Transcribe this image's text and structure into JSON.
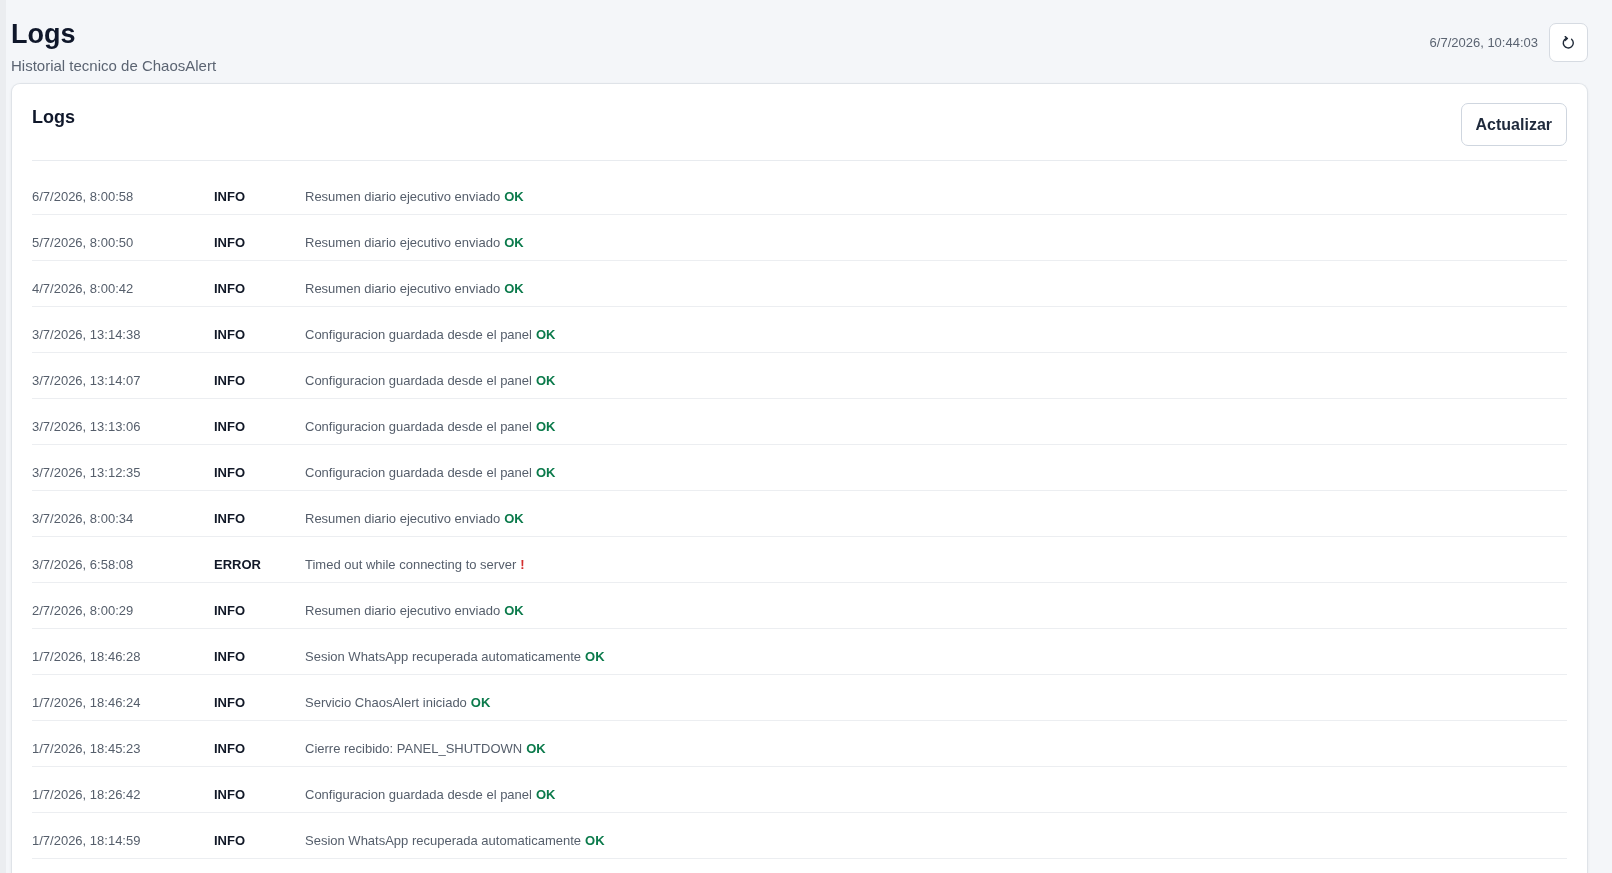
{
  "header": {
    "title": "Logs",
    "subtitle": "Historial tecnico de ChaosAlert",
    "timestamp": "6/7/2026, 10:44:03"
  },
  "card": {
    "title": "Logs",
    "button": "Actualizar"
  },
  "logs": [
    {
      "time": "6/7/2026, 8:00:58",
      "level": "INFO",
      "message": "Resumen diario ejecutivo enviado",
      "status": {
        "text": "OK",
        "kind": "ok"
      }
    },
    {
      "time": "5/7/2026, 8:00:50",
      "level": "INFO",
      "message": "Resumen diario ejecutivo enviado",
      "status": {
        "text": "OK",
        "kind": "ok"
      }
    },
    {
      "time": "4/7/2026, 8:00:42",
      "level": "INFO",
      "message": "Resumen diario ejecutivo enviado",
      "status": {
        "text": "OK",
        "kind": "ok"
      }
    },
    {
      "time": "3/7/2026, 13:14:38",
      "level": "INFO",
      "message": "Configuracion guardada desde el panel",
      "status": {
        "text": "OK",
        "kind": "ok"
      }
    },
    {
      "time": "3/7/2026, 13:14:07",
      "level": "INFO",
      "message": "Configuracion guardada desde el panel",
      "status": {
        "text": "OK",
        "kind": "ok"
      }
    },
    {
      "time": "3/7/2026, 13:13:06",
      "level": "INFO",
      "message": "Configuracion guardada desde el panel",
      "status": {
        "text": "OK",
        "kind": "ok"
      }
    },
    {
      "time": "3/7/2026, 13:12:35",
      "level": "INFO",
      "message": "Configuracion guardada desde el panel",
      "status": {
        "text": "OK",
        "kind": "ok"
      }
    },
    {
      "time": "3/7/2026, 8:00:34",
      "level": "INFO",
      "message": "Resumen diario ejecutivo enviado",
      "status": {
        "text": "OK",
        "kind": "ok"
      }
    },
    {
      "time": "3/7/2026, 6:58:08",
      "level": "ERROR",
      "message": "Timed out while connecting to server",
      "status": {
        "text": "!",
        "kind": "error"
      }
    },
    {
      "time": "2/7/2026, 8:00:29",
      "level": "INFO",
      "message": "Resumen diario ejecutivo enviado",
      "status": {
        "text": "OK",
        "kind": "ok"
      }
    },
    {
      "time": "1/7/2026, 18:46:28",
      "level": "INFO",
      "message": "Sesion WhatsApp recuperada automaticamente",
      "status": {
        "text": "OK",
        "kind": "ok"
      }
    },
    {
      "time": "1/7/2026, 18:46:24",
      "level": "INFO",
      "message": "Servicio ChaosAlert iniciado",
      "status": {
        "text": "OK",
        "kind": "ok"
      }
    },
    {
      "time": "1/7/2026, 18:45:23",
      "level": "INFO",
      "message": "Cierre recibido: PANEL_SHUTDOWN",
      "status": {
        "text": "OK",
        "kind": "ok"
      }
    },
    {
      "time": "1/7/2026, 18:26:42",
      "level": "INFO",
      "message": "Configuracion guardada desde el panel",
      "status": {
        "text": "OK",
        "kind": "ok"
      }
    },
    {
      "time": "1/7/2026, 18:14:59",
      "level": "INFO",
      "message": "Sesion WhatsApp recuperada automaticamente",
      "status": {
        "text": "OK",
        "kind": "ok"
      }
    }
  ]
}
